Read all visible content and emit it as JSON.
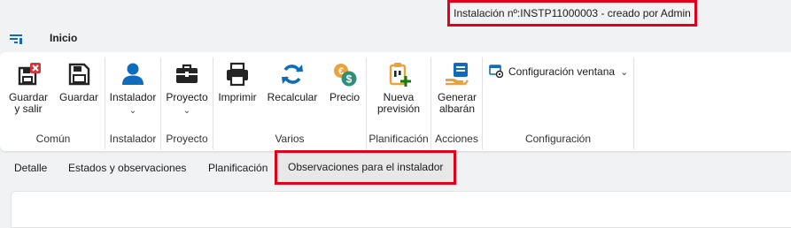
{
  "window": {
    "title": "Instalación nº:INSTP11000003 - creado por Admin"
  },
  "menu": {
    "home_tab": "Inicio"
  },
  "ribbon": {
    "buttons": {
      "save_close": {
        "line1": "Guardar",
        "line2": "y salir",
        "icon": "save-close-icon"
      },
      "save": {
        "label": "Guardar",
        "icon": "save-icon"
      },
      "installer": {
        "label": "Instalador",
        "icon": "person-icon"
      },
      "project": {
        "label": "Proyecto",
        "icon": "briefcase-icon"
      },
      "print": {
        "label": "Imprimir",
        "icon": "printer-icon"
      },
      "recalc": {
        "label": "Recalcular",
        "icon": "refresh-icon"
      },
      "price": {
        "label": "Precio",
        "icon": "price-icon"
      },
      "new_forecast": {
        "line1": "Nueva",
        "line2": "previsión",
        "icon": "clipboard-add-icon"
      },
      "delivery_note": {
        "line1": "Generar",
        "line2": "albarán",
        "icon": "delivery-note-icon"
      },
      "window_config": {
        "label": "Configuración ventana",
        "icon": "window-settings-icon"
      }
    },
    "groups": {
      "common": "Común",
      "installer": "Instalador",
      "project": "Proyecto",
      "various": "Varios",
      "planning": "Planificación",
      "actions": "Acciones",
      "configuration": "Configuración"
    }
  },
  "tabs": [
    {
      "label": "Detalle"
    },
    {
      "label": "Estados y observaciones"
    },
    {
      "label": "Planificación"
    },
    {
      "label": "Observaciones para el instalador",
      "active": true
    }
  ],
  "colors": {
    "accent": "#0f6cbd",
    "highlight": "#e2001a",
    "danger": "#d13438",
    "success": "#107c10",
    "gold": "#e8a33d"
  }
}
